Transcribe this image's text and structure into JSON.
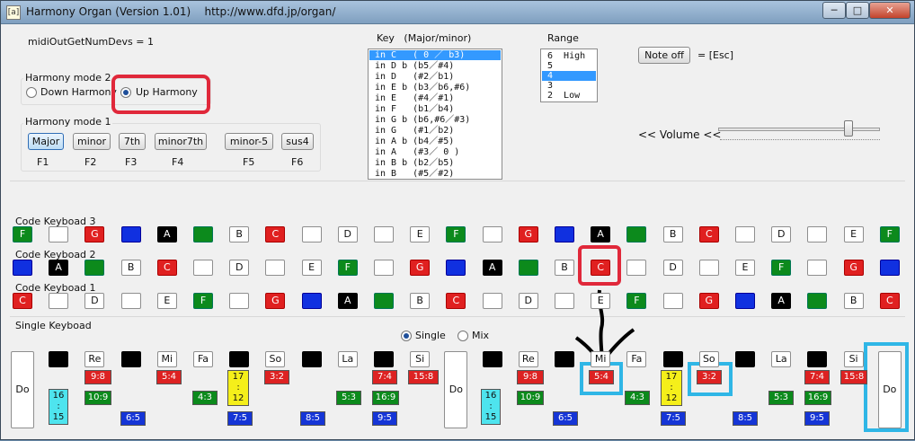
{
  "window": {
    "title": "Harmony Organ (Version 1.01)    http://www.dfd.jp/organ/",
    "icon": "[a]",
    "minimize": "─",
    "maximize": "□",
    "close": "✕"
  },
  "midi": {
    "text": "midiOutGetNumDevs = 1"
  },
  "harmony_mode2": {
    "label": "Harmony mode 2",
    "down": "Down Harmony",
    "up": "Up Harmony",
    "selected": "Up Harmony"
  },
  "harmony_mode1": {
    "label": "Harmony mode 1",
    "buttons": [
      "Major",
      "minor",
      "7th",
      "minor7th",
      "minor-5",
      "sus4"
    ],
    "fkeys": [
      "F1",
      "F2",
      "F3",
      "F4",
      "F5",
      "F6"
    ],
    "selected": "Major"
  },
  "key": {
    "label": "Key   (Major/minor)",
    "items": [
      "in C   ( 0 ／ b3)",
      "in D b (b5／#4)",
      "in D   (#2／b1)",
      "in E b (b3／b6,#6)",
      "in E   (#4／#1)",
      "in F   (b1／b4)",
      "in G b (b6,#6／#3)",
      "in G   (#1／b2)",
      "in A b (b4／#5)",
      "in A   (#3／ 0 )",
      "in B b (b2／b5)",
      "in B   (#5／#2)"
    ],
    "selected": 0
  },
  "range": {
    "label": "Range",
    "items": [
      "6  High",
      "5",
      "4",
      "3",
      "2  Low"
    ],
    "selected": 2
  },
  "noteoff": {
    "button": "Note off",
    "hint": "= [Esc]"
  },
  "volume": {
    "label": "<< Volume <<",
    "value": 0.85
  },
  "code3": {
    "label": "Code Keyboad 3",
    "keys": [
      [
        "F",
        "green"
      ],
      [
        "",
        "white"
      ],
      [
        "G",
        "red"
      ],
      [
        "",
        "blue"
      ],
      [
        "A",
        "black"
      ],
      [
        "",
        "green"
      ],
      [
        "B",
        "white"
      ],
      [
        "C",
        "red"
      ],
      [
        "",
        "white"
      ],
      [
        "D",
        "white"
      ],
      [
        "",
        "white"
      ],
      [
        "E",
        "white"
      ],
      [
        "F",
        "green"
      ],
      [
        "",
        "white"
      ],
      [
        "G",
        "red"
      ],
      [
        "",
        "blue"
      ],
      [
        "A",
        "black"
      ],
      [
        "",
        "green"
      ],
      [
        "B",
        "white"
      ],
      [
        "C",
        "red"
      ],
      [
        "",
        "white"
      ],
      [
        "D",
        "white"
      ],
      [
        "",
        "white"
      ],
      [
        "E",
        "white"
      ],
      [
        "F",
        "green"
      ]
    ]
  },
  "code2": {
    "label": "Code Keyboad 2",
    "keys": [
      [
        "",
        "blue"
      ],
      [
        "A",
        "black"
      ],
      [
        "",
        "green"
      ],
      [
        "B",
        "white"
      ],
      [
        "C",
        "red"
      ],
      [
        "",
        "white"
      ],
      [
        "D",
        "white"
      ],
      [
        "",
        "white"
      ],
      [
        "E",
        "white"
      ],
      [
        "F",
        "green"
      ],
      [
        "",
        "white"
      ],
      [
        "G",
        "red"
      ],
      [
        "",
        "blue"
      ],
      [
        "A",
        "black"
      ],
      [
        "",
        "green"
      ],
      [
        "B",
        "white"
      ],
      [
        "C",
        "red"
      ],
      [
        "",
        "white"
      ],
      [
        "D",
        "white"
      ],
      [
        "",
        "white"
      ],
      [
        "E",
        "white"
      ],
      [
        "F",
        "green"
      ],
      [
        "",
        "white"
      ],
      [
        "G",
        "red"
      ],
      [
        "",
        "blue"
      ]
    ]
  },
  "code1": {
    "label": "Code Keyboad 1",
    "keys": [
      [
        "C",
        "red"
      ],
      [
        "",
        "white"
      ],
      [
        "D",
        "white"
      ],
      [
        "",
        "white"
      ],
      [
        "E",
        "white"
      ],
      [
        "F",
        "green"
      ],
      [
        "",
        "white"
      ],
      [
        "G",
        "red"
      ],
      [
        "",
        "blue"
      ],
      [
        "A",
        "black"
      ],
      [
        "",
        "green"
      ],
      [
        "B",
        "white"
      ],
      [
        "C",
        "red"
      ],
      [
        "",
        "white"
      ],
      [
        "D",
        "white"
      ],
      [
        "",
        "white"
      ],
      [
        "E",
        "white"
      ],
      [
        "F",
        "green"
      ],
      [
        "",
        "white"
      ],
      [
        "G",
        "red"
      ],
      [
        "",
        "blue"
      ],
      [
        "A",
        "black"
      ],
      [
        "",
        "green"
      ],
      [
        "B",
        "white"
      ],
      [
        "C",
        "red"
      ]
    ]
  },
  "single": {
    "label": "Single Keyboad",
    "mode_single": "Single",
    "mode_mix": "Mix",
    "selected": "Single",
    "notes": [
      "Do",
      "",
      "Re",
      "",
      "Mi",
      "Fa",
      "",
      "So",
      "",
      "La",
      "",
      "Si",
      "Do",
      "",
      "Re",
      "",
      "Mi",
      "Fa",
      "",
      "So",
      "",
      "La",
      "",
      "Si",
      "Do"
    ],
    "ratios": {
      "r98": "9:8",
      "r109": "10:9",
      "r1615": "16\n:\n15",
      "r65": "6:5",
      "r54": "5:4",
      "r43": "4:3",
      "r1712": "17\n:\n12",
      "r75": "7:5",
      "r32": "3:2",
      "r85": "8:5",
      "r53": "5:3",
      "r74": "7:4",
      "r169": "16:9",
      "r95": "9:5",
      "r158": "15:8"
    }
  },
  "colors": {
    "red": "#e02020",
    "green": "#0c8a1c",
    "blue": "#1030e0",
    "annot_red": "#e0283a",
    "annot_cyan": "#2fb6e6"
  }
}
